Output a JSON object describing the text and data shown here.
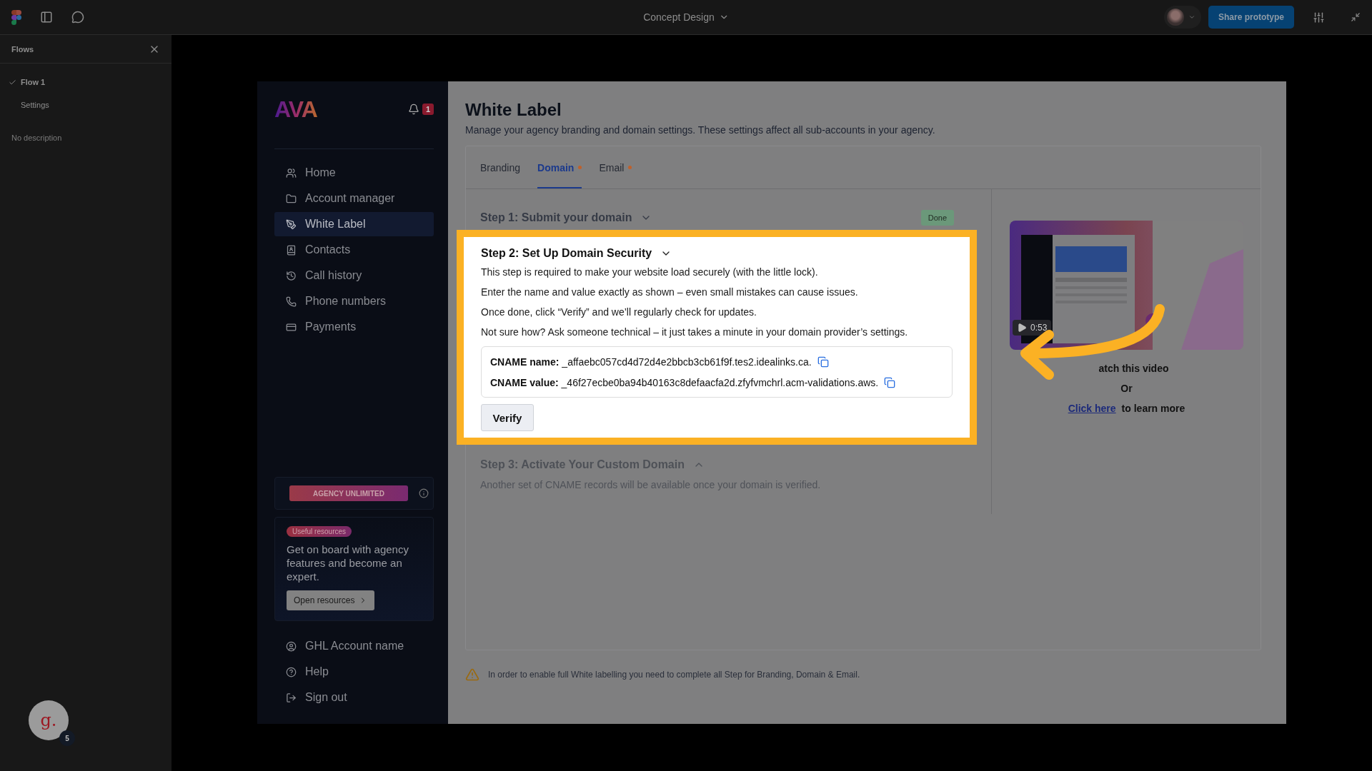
{
  "figma": {
    "file_title": "Concept Design",
    "share_button": "Share prototype",
    "flows_panel": {
      "title": "Flows",
      "flows": [
        {
          "label": "Flow 1",
          "checked": true
        },
        {
          "label": "Settings",
          "checked": false
        }
      ],
      "description": "No description"
    },
    "user_badge": {
      "letter": "g.",
      "count": "5"
    }
  },
  "app": {
    "logo": "AVA",
    "notifications": "1",
    "nav": [
      {
        "label": "Home",
        "selected": false
      },
      {
        "label": "Account manager",
        "selected": false
      },
      {
        "label": "White Label",
        "selected": true
      },
      {
        "label": "Contacts",
        "selected": false
      },
      {
        "label": "Call history",
        "selected": false
      },
      {
        "label": "Phone numbers",
        "selected": false
      },
      {
        "label": "Payments",
        "selected": false
      }
    ],
    "plan": "AGENCY UNLIMITED",
    "resources": {
      "tag": "Useful resources",
      "text": "Get on board with agency features and become an expert.",
      "button": "Open resources"
    },
    "bottom_nav": [
      {
        "label": "GHL Account name"
      },
      {
        "label": "Help"
      },
      {
        "label": "Sign out"
      }
    ]
  },
  "page": {
    "title": "White Label",
    "subtitle": "Manage your agency branding and domain settings. These settings affect all sub-accounts in your agency.",
    "tabs": [
      {
        "label": "Branding",
        "selected": false,
        "pending": false
      },
      {
        "label": "Domain",
        "selected": true,
        "pending": true
      },
      {
        "label": "Email",
        "selected": false,
        "pending": true
      }
    ],
    "steps": [
      {
        "kind": "done",
        "title": "Step 1: Submit your domain",
        "badge": "Done"
      },
      {
        "kind": "active",
        "title": "Step 2: Set Up Domain Security",
        "highlighted": true,
        "paragraphs": [
          "This step is required to make your website load securely (with the little lock).",
          "Enter the name and value exactly as shown – even small mistakes can cause issues.",
          "Once done, click “Verify” and we’ll regularly check for updates.",
          "Not sure how? Ask someone technical – it just takes a minute in your domain provider’s settings."
        ],
        "records": [
          {
            "label": "CNAME name:",
            "value": "_affaebc057cd4d72d4e2bbcb3cb61f9f.tes2.idealinks.ca."
          },
          {
            "label": "CNAME value:",
            "value": "_46f27ecbe0ba94b40163c8defaacfa2d.zfyfvmchrl.acm-validations.aws."
          }
        ],
        "button": "Verify"
      },
      {
        "kind": "locked",
        "title": "Step 3: Activate Your Custom Domain",
        "note": "Another set of CNAME records will be available once your domain is verified."
      }
    ],
    "video": {
      "duration": "0:53",
      "watch": "atch this video",
      "or": "Or",
      "link": "Click here",
      "link_suffix": "to learn more"
    },
    "warning": "In order to enable full White labelling you need to complete all Step for Branding, Domain & Email."
  }
}
